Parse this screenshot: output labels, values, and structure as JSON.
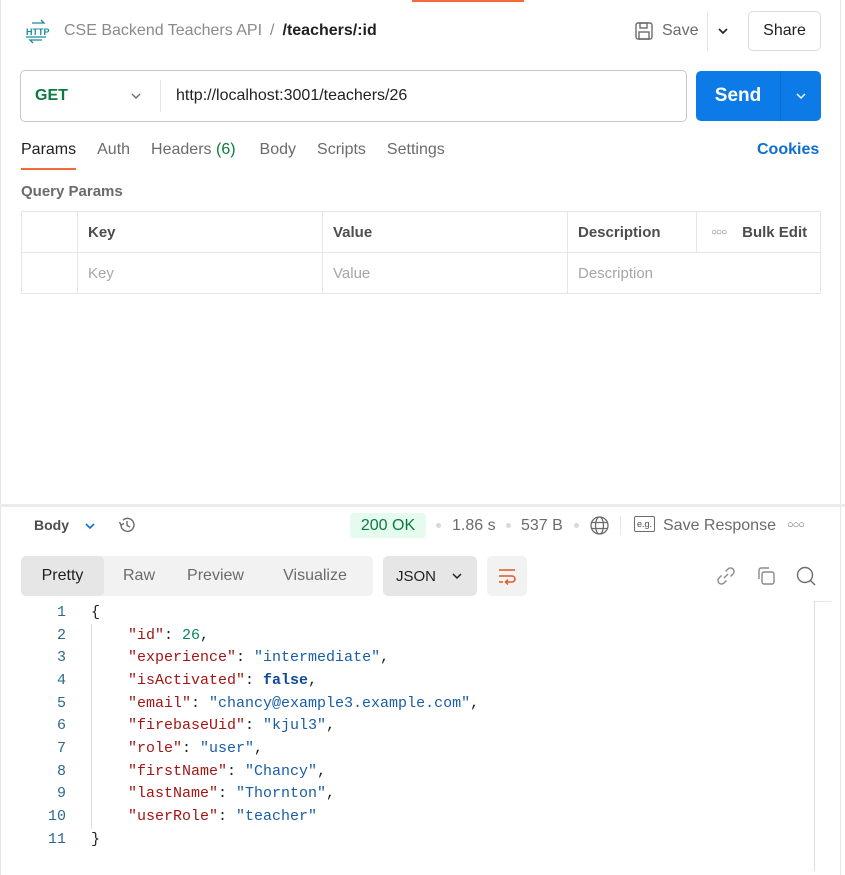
{
  "header": {
    "collection": "CSE Backend Teachers API",
    "separator": "/",
    "request_name": "/teachers/:id",
    "save_label": "Save",
    "share_label": "Share",
    "icon": "http-icon"
  },
  "request": {
    "method": "GET",
    "url": "http://localhost:3001/teachers/26",
    "send_label": "Send",
    "method_color": "#0b7a3e",
    "send_color": "#0c7be8"
  },
  "tabs": {
    "items": [
      {
        "label": "Params",
        "active": true
      },
      {
        "label": "Auth"
      },
      {
        "label": "Headers",
        "count": "(6)"
      },
      {
        "label": "Body"
      },
      {
        "label": "Scripts"
      },
      {
        "label": "Settings"
      }
    ],
    "cookies_label": "Cookies"
  },
  "query_params": {
    "title": "Query Params",
    "columns": [
      "Key",
      "Value",
      "Description"
    ],
    "bulk_edit_label": "Bulk Edit",
    "placeholders": {
      "key": "Key",
      "value": "Value",
      "description": "Description"
    }
  },
  "response": {
    "body_label": "Body",
    "status": "200 OK",
    "time": "1.86 s",
    "size": "537 B",
    "save_response_label": "Save Response",
    "eg_label": "e.g.",
    "view_tabs": [
      "Pretty",
      "Raw",
      "Preview",
      "Visualize"
    ],
    "active_view": "Pretty",
    "format": "JSON",
    "status_color": "#0b7a3e",
    "lines": [
      {
        "n": "1"
      },
      {
        "n": "2",
        "key": "\"id\"",
        "value": "26",
        "type": "number",
        "comma": ","
      },
      {
        "n": "3",
        "key": "\"experience\"",
        "value": "\"intermediate\"",
        "type": "string",
        "comma": ","
      },
      {
        "n": "4",
        "key": "\"isActivated\"",
        "value": "false",
        "type": "bool",
        "comma": ","
      },
      {
        "n": "5",
        "key": "\"email\"",
        "value": "\"chancy@example3.example.com\"",
        "type": "string",
        "comma": ","
      },
      {
        "n": "6",
        "key": "\"firebaseUid\"",
        "value": "\"kjul3\"",
        "type": "string",
        "comma": ","
      },
      {
        "n": "7",
        "key": "\"role\"",
        "value": "\"user\"",
        "type": "string",
        "comma": ","
      },
      {
        "n": "8",
        "key": "\"firstName\"",
        "value": "\"Chancy\"",
        "type": "string",
        "comma": ","
      },
      {
        "n": "9",
        "key": "\"lastName\"",
        "value": "\"Thornton\"",
        "type": "string",
        "comma": ","
      },
      {
        "n": "10",
        "key": "\"userRole\"",
        "value": "\"teacher\"",
        "type": "string",
        "comma": ""
      },
      {
        "n": "11"
      }
    ],
    "open_brace": "{",
    "close_brace": "}",
    "colon": ": "
  }
}
